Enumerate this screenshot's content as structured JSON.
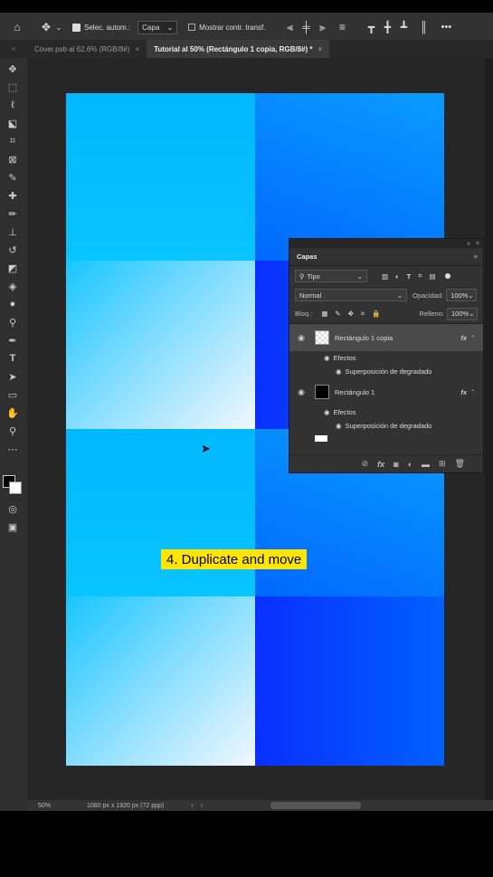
{
  "options_bar": {
    "auto_select_label": "Selec. autom.:",
    "auto_select_target": "Capa",
    "show_transform_label": "Mostrar contr. transf.",
    "more": "•••"
  },
  "tabs": [
    {
      "label": "Cover.psb al 62,6% (RGB/8#)",
      "close": "×"
    },
    {
      "label": "Tutorial al 50% (Rectángulo 1 copia, RGB/8#) *",
      "close": "×"
    }
  ],
  "caption": "4. Duplicate and move",
  "status": {
    "zoom": "50%",
    "doc_info": "1080 px x 1920 px (72 ppp)",
    "arrow_right": "›",
    "arrow_left": "‹"
  },
  "layers_panel": {
    "title": "Capas",
    "filter_kind": "Tipo",
    "blend_mode": "Normal",
    "opacity_label": "Opacidad:",
    "opacity_value": "100%",
    "lock_label": "Bloq.:",
    "fill_label": "Relleno:",
    "fill_value": "100%",
    "collapse": "«",
    "close": "×",
    "layers": [
      {
        "name": "Rectángulo 1 copia",
        "fx": "fx",
        "effects_label": "Efectos",
        "effect": "Superposición de degradado"
      },
      {
        "name": "Rectángulo 1",
        "fx": "fx",
        "effects_label": "Efectos",
        "effect": "Superposición de degradado"
      }
    ],
    "bottom_link": "⊘",
    "bottom_fx": "fx"
  },
  "icons": [
    "home-icon",
    "move-icon",
    "marquee-icon",
    "lasso-icon",
    "crop-icon",
    "eyedropper-icon",
    "brush-icon",
    "text-icon",
    "hand-icon",
    "zoom-icon",
    "eye-icon",
    "trash-icon"
  ],
  "colors": {
    "accent_yellow": "#ffe500",
    "cyan": "#00b8ff",
    "blue": "#0069ff",
    "panel_bg": "#323232"
  }
}
